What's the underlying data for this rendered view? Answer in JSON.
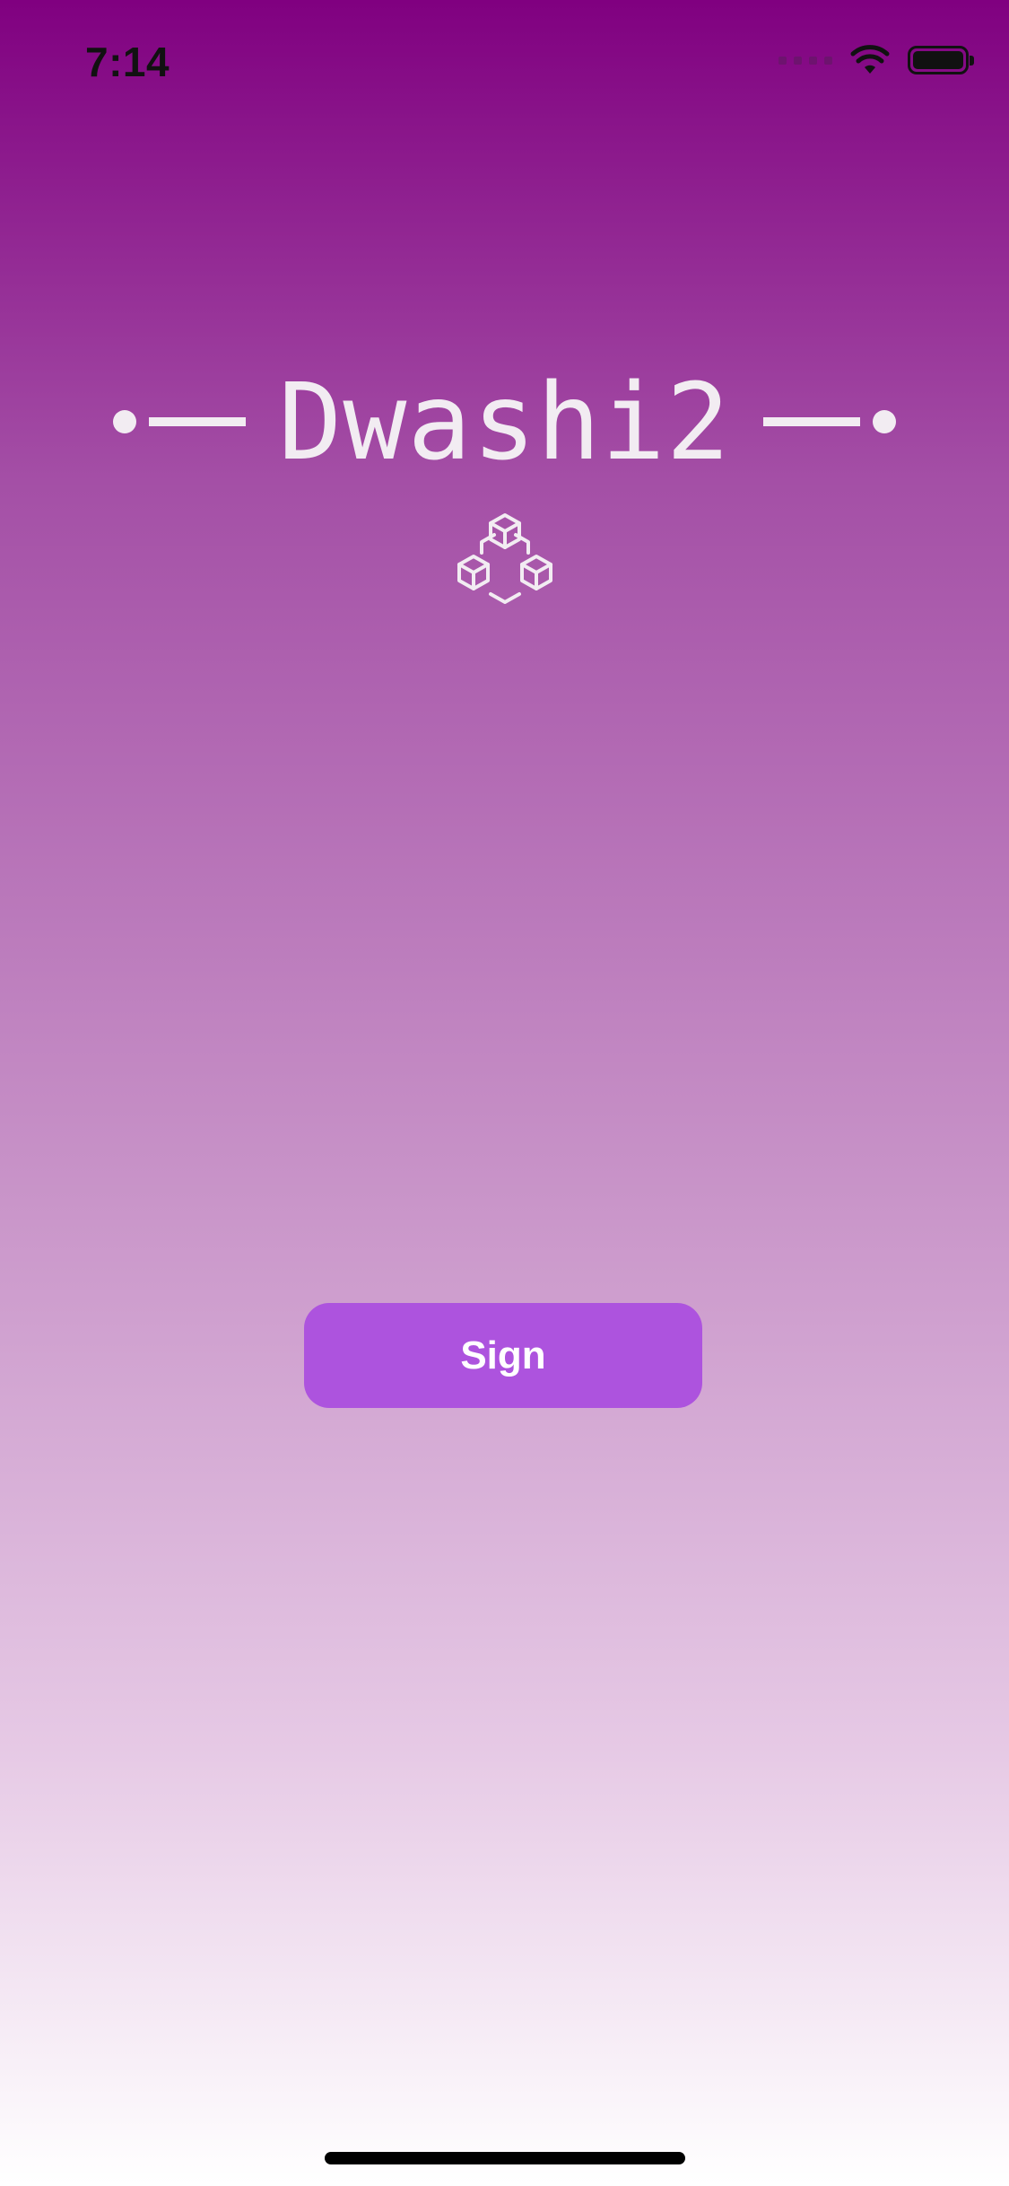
{
  "status_bar": {
    "time": "7:14",
    "battery_level": 1.0,
    "icons": [
      "signal-icon",
      "wifi-icon",
      "battery-icon"
    ]
  },
  "app": {
    "title": "Dwashi2",
    "logo_icon": "cubes-icon"
  },
  "actions": {
    "sign_label": "Sign"
  },
  "colors": {
    "gradient_top": "#800080",
    "gradient_bottom": "#ffffff",
    "button": "#ad53de",
    "title_text": "#f2ecf2"
  }
}
